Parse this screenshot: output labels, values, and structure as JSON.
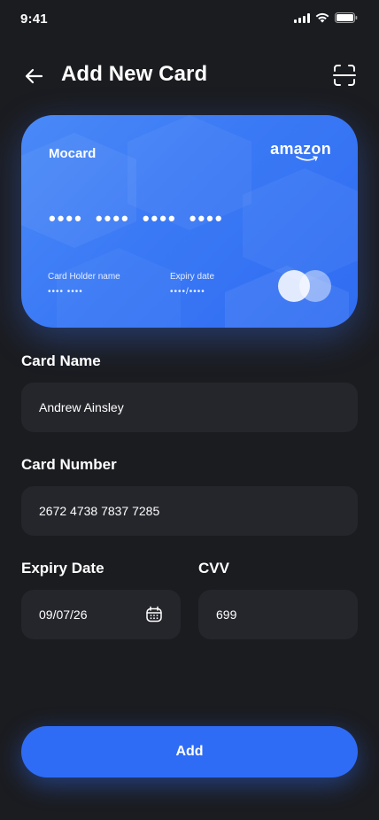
{
  "status": {
    "time": "9:41"
  },
  "header": {
    "title": "Add New Card"
  },
  "card": {
    "brand": "Mocard",
    "issuer": "amazon",
    "number_masked": "•••• •••• •••• ••••",
    "holder_label": "Card Holder name",
    "holder_value": "•••• ••••",
    "expiry_label": "Expiry date",
    "expiry_value": "••••/••••"
  },
  "form": {
    "card_name": {
      "label": "Card Name",
      "value": "Andrew Ainsley"
    },
    "card_number": {
      "label": "Card Number",
      "value": "2672 4738 7837 7285"
    },
    "expiry": {
      "label": "Expiry Date",
      "value": "09/07/26"
    },
    "cvv": {
      "label": "CVV",
      "value": "699"
    }
  },
  "actions": {
    "add_label": "Add"
  },
  "colors": {
    "background": "#1b1c20",
    "field": "#25262c",
    "accent": "#2f6cf5"
  }
}
